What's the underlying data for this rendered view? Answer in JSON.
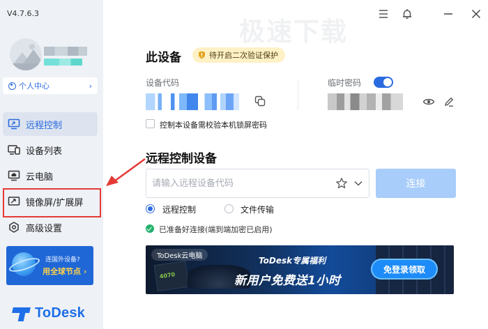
{
  "app": {
    "version": "V4.7.6.3",
    "watermark": "极速下载"
  },
  "sidebar": {
    "user_center": "个人中心",
    "items": [
      {
        "label": "远程控制",
        "icon": "monitor-icon"
      },
      {
        "label": "设备列表",
        "icon": "devices-icon"
      },
      {
        "label": "云电脑",
        "icon": "cloud-pc-icon"
      },
      {
        "label": "镜像屏/扩展屏",
        "icon": "mirror-screen-icon"
      },
      {
        "label": "高级设置",
        "icon": "gear-icon"
      }
    ],
    "promo": {
      "line1": "连国外设备?",
      "line2": "用全球节点 ›"
    },
    "logo": "ToDesk"
  },
  "main": {
    "device": {
      "title": "此设备",
      "security_badge": "待开启二次验证保护",
      "code_label": "设备代码",
      "temp_password_label": "临时密码",
      "temp_password_enabled": true,
      "lock_checkbox_label": "控制本设备需校验本机锁屏密码",
      "lock_checkbox_checked": false
    },
    "remote": {
      "title": "远程控制设备",
      "input_placeholder": "请输入远程设备代码",
      "connect_label": "连接",
      "mode_options": [
        "远程控制",
        "文件传输"
      ],
      "selected_mode": "远程控制",
      "status": "已准备好连接(端到端加密已启用)"
    },
    "banner": {
      "tag": "ToDesk云电脑",
      "headline": "ToDesk专属福利",
      "subline": "新用户免费送1小时",
      "cta": "免登录领取",
      "gpu_text": "4070"
    }
  },
  "colors": {
    "accent": "#2b6be0",
    "annotation": "#e53935",
    "connect_disabled": "#a8cdfa",
    "badge_bg": "#fff1c6"
  }
}
